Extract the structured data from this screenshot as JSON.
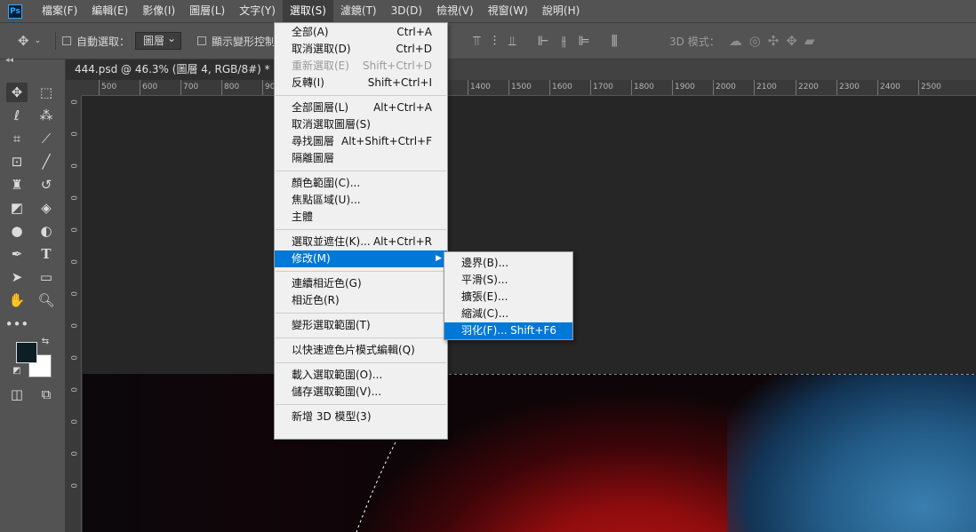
{
  "app": {
    "logo": "Ps"
  },
  "menubar": {
    "items": [
      "檔案(F)",
      "編輯(E)",
      "影像(I)",
      "圖層(L)",
      "文字(Y)",
      "選取(S)",
      "濾鏡(T)",
      "3D(D)",
      "檢視(V)",
      "視窗(W)",
      "說明(H)"
    ]
  },
  "options": {
    "auto_select_label": "自動選取：",
    "auto_select_value": "圖層",
    "transform_controls_label": "顯示變形控制",
    "mode_3d_label": "3D 模式："
  },
  "document": {
    "tab_title": "444.psd @ 46.3% (圖層 4, RGB/8#) *",
    "close_glyph": "×"
  },
  "ruler": {
    "top_labels": [
      "500",
      "600",
      "700",
      "800",
      "90",
      "1400",
      "1500",
      "1600",
      "1700",
      "1800",
      "1900",
      "2000",
      "2100",
      "2200",
      "2300",
      "2400",
      "2500"
    ],
    "left_labels": [
      "0",
      "0",
      "0",
      "0",
      "0",
      "0",
      "0",
      "0",
      "0",
      "0",
      "0",
      "0",
      "0"
    ]
  },
  "select_menu": {
    "group1": [
      {
        "label": "全部(A)",
        "shortcut": "Ctrl+A"
      },
      {
        "label": "取消選取(D)",
        "shortcut": "Ctrl+D"
      },
      {
        "label": "重新選取(E)",
        "shortcut": "Shift+Ctrl+D"
      },
      {
        "label": "反轉(I)",
        "shortcut": "Shift+Ctrl+I"
      }
    ],
    "group2": [
      {
        "label": "全部圖層(L)",
        "shortcut": "Alt+Ctrl+A"
      },
      {
        "label": "取消選取圖層(S)",
        "shortcut": ""
      },
      {
        "label": "尋找圖層",
        "shortcut": "Alt+Shift+Ctrl+F"
      },
      {
        "label": "隔離圖層",
        "shortcut": ""
      }
    ],
    "group3": [
      {
        "label": "顏色範圍(C)...",
        "shortcut": ""
      },
      {
        "label": "焦點區域(U)...",
        "shortcut": ""
      },
      {
        "label": "主體",
        "shortcut": ""
      }
    ],
    "group4": [
      {
        "label": "選取並遮住(K)...",
        "shortcut": "Alt+Ctrl+R"
      },
      {
        "label": "修改(M)",
        "shortcut": ""
      }
    ],
    "group5": [
      {
        "label": "連續相近色(G)",
        "shortcut": ""
      },
      {
        "label": "相近色(R)",
        "shortcut": ""
      }
    ],
    "group6": [
      {
        "label": "變形選取範圍(T)"
      }
    ],
    "group7": [
      {
        "label": "以快速遮色片模式編輯(Q)"
      }
    ],
    "group8": [
      {
        "label": "載入選取範圍(O)..."
      },
      {
        "label": "儲存選取範圍(V)..."
      }
    ],
    "group9": [
      {
        "label": "新增 3D 模型(3)"
      }
    ]
  },
  "modify_menu": {
    "items": [
      {
        "label": "邊界(B)...",
        "shortcut": ""
      },
      {
        "label": "平滑(S)...",
        "shortcut": ""
      },
      {
        "label": "擴張(E)...",
        "shortcut": ""
      },
      {
        "label": "縮減(C)...",
        "shortcut": ""
      },
      {
        "label": "羽化(F)...",
        "shortcut": "Shift+F6"
      }
    ]
  },
  "colors": {
    "foreground": "#0d1e25",
    "background": "#ffffff",
    "menu_highlight": "#0078d7"
  },
  "icons": [
    "move-tool-icon",
    "marquee-tool-icon",
    "lasso-tool-icon",
    "magic-wand-icon",
    "crop-tool-icon",
    "eyedropper-icon",
    "frame-tool-icon",
    "brush-tool-icon",
    "stamp-tool-icon",
    "history-brush-icon",
    "eraser-icon",
    "paint-bucket-icon",
    "blur-tool-icon",
    "dodge-tool-icon",
    "pen-tool-icon",
    "type-tool-icon",
    "path-select-icon",
    "rectangle-tool-icon",
    "hand-tool-icon",
    "zoom-tool-icon",
    "more-tools-icon"
  ]
}
